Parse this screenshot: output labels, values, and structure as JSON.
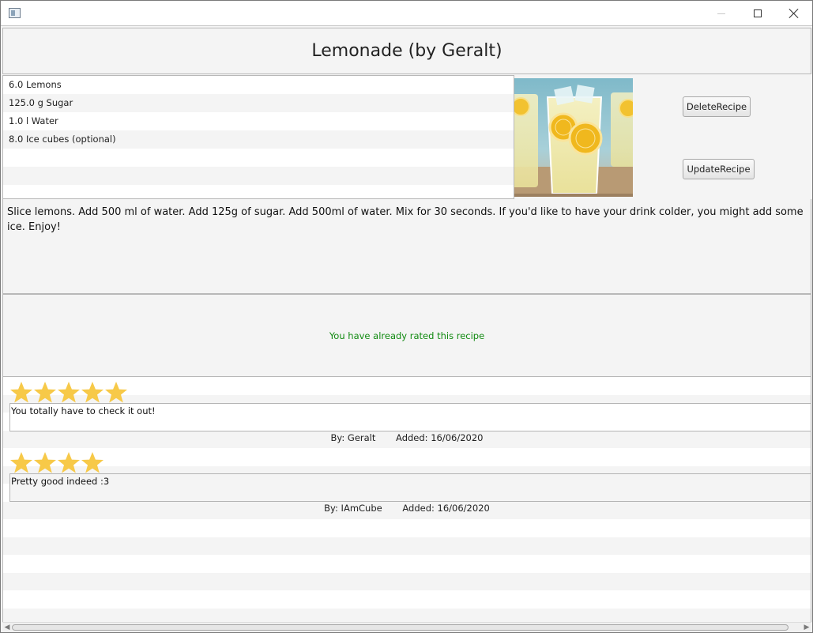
{
  "window": {
    "icon": "app-window-icon",
    "controls": {
      "minimize": "minimize-icon",
      "maximize": "maximize-icon",
      "close": "close-icon"
    }
  },
  "header": {
    "title": "Lemonade (by Geralt)"
  },
  "ingredients": [
    {
      "text": "6.0  Lemons"
    },
    {
      "text": "125.0 g Sugar"
    },
    {
      "text": "1.0 l Water"
    },
    {
      "text": "8.0  Ice cubes (optional)"
    },
    {
      "text": ""
    },
    {
      "text": ""
    }
  ],
  "buttons": {
    "delete_label": "DeleteRecipe",
    "update_label": "UpdateRecipe"
  },
  "description": {
    "text": "Slice lemons. Add 500 ml of water. Add 125g of sugar. Add 500ml of water. Mix for 30 seconds. If you'd like to have your drink colder, you might add some ice. Enjoy!"
  },
  "rating": {
    "message": "You have already rated this recipe",
    "message_color": "#118a11"
  },
  "reviews": [
    {
      "stars": 5,
      "comment": "You totally have to check it out!",
      "by": "By: Geralt",
      "added": "Added: 16/06/2020"
    },
    {
      "stars": 4,
      "comment": "Pretty good indeed :3",
      "by": "By: IAmCube",
      "added": "Added: 16/06/2020"
    }
  ],
  "colors": {
    "star": "#f7c948",
    "accent_text": "#118a11"
  }
}
